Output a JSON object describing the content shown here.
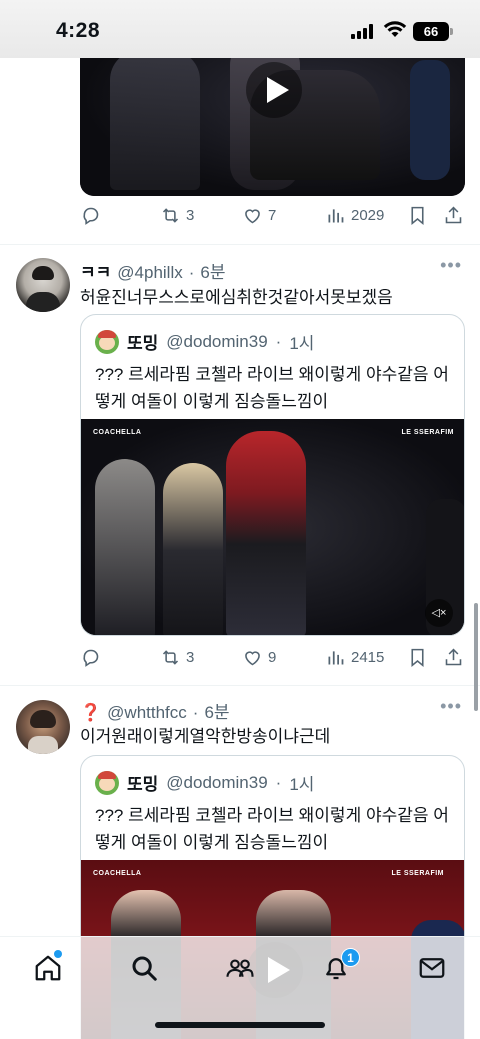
{
  "status_bar": {
    "time": "4:28",
    "battery": "66"
  },
  "tweets": [
    {
      "actions": {
        "replies": "",
        "retweets": "3",
        "likes": "7",
        "views": "2029"
      }
    },
    {
      "author_name": "ㅋㅋ",
      "handle": "@4phillx",
      "time": "6분",
      "text": "허윤진너무스스로에심취한것같아서못보겠음",
      "quote": {
        "author_name": "또밍",
        "handle": "@dodomin39",
        "time": "1시",
        "text": "??? 르세라핌 코첼라 라이브 왜이렇게 야수같음 어떻게 여돌이 이렇게 짐승돌느낌이",
        "media_labels": {
          "left": "COACHELLA",
          "right": "LE SSERAFIM"
        }
      },
      "actions": {
        "replies": "",
        "retweets": "3",
        "likes": "9",
        "views": "2415"
      }
    },
    {
      "author_name": "❓",
      "handle": "@whtthfcc",
      "time": "6분",
      "text": "이거원래이렇게열악한방송이냐근데",
      "quote": {
        "author_name": "또밍",
        "handle": "@dodomin39",
        "time": "1시",
        "text": "??? 르세라핌 코첼라 라이브 왜이렇게 야수같음 어떻게 여돌이 이렇게 짐승돌느낌이",
        "media_labels": {
          "left": "COACHELLA",
          "right": "LE SSERAFIM"
        }
      }
    }
  ],
  "tabbar": {
    "notifications_badge": "1"
  },
  "icons": [
    "reply-icon",
    "retweet-icon",
    "like-icon",
    "views-icon",
    "bookmark-icon",
    "share-icon",
    "home-icon",
    "search-icon",
    "communities-icon",
    "notifications-icon",
    "messages-icon",
    "play-icon",
    "mute-icon"
  ]
}
